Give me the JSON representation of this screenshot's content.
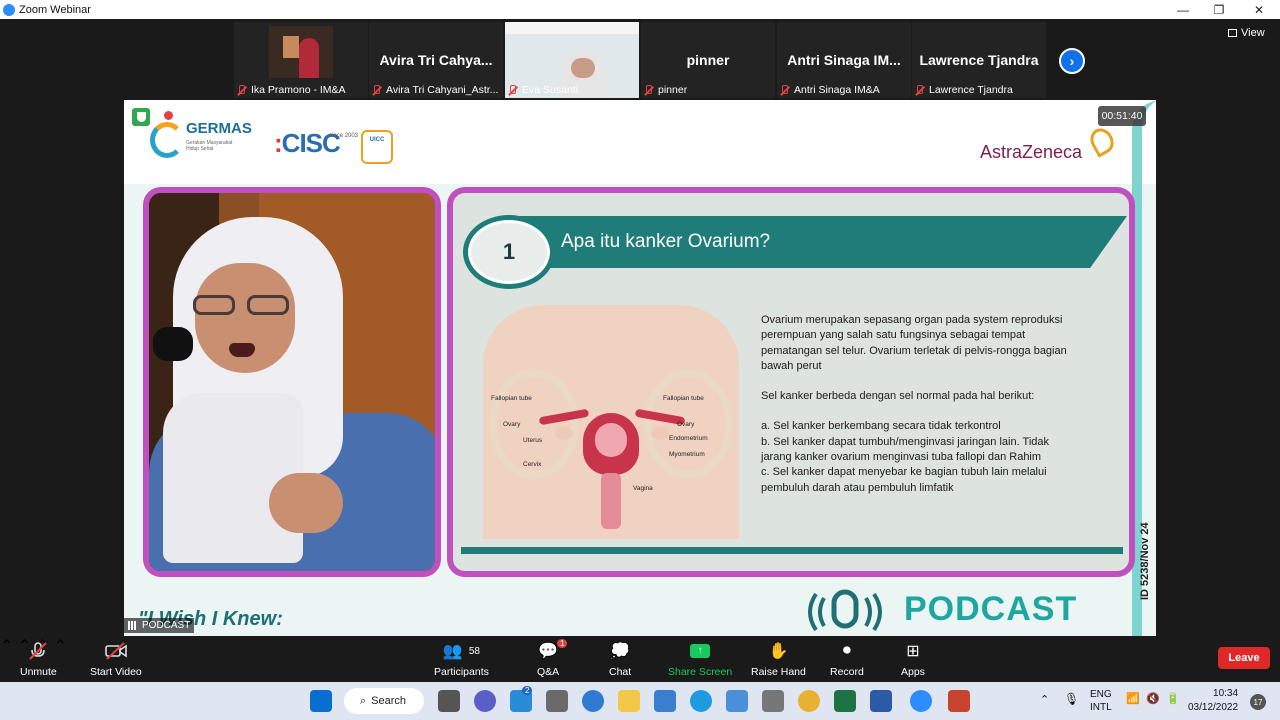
{
  "window": {
    "title": "Zoom Webinar",
    "controls": [
      "—",
      "❐",
      "✕"
    ]
  },
  "participants_strip": {
    "tiles": [
      {
        "display_name": "",
        "label": "Ika Pramono - IM&A",
        "has_video": true
      },
      {
        "display_name": "Avira Tri Cahya...",
        "label": "Avira Tri Cahyani_Astr...",
        "has_video": false
      },
      {
        "display_name": "",
        "label": "Eva Susanti",
        "has_video": true
      },
      {
        "display_name": "pinner",
        "label": "pinner",
        "has_video": false
      },
      {
        "display_name": "Antri Sinaga IM...",
        "label": "Antri Sinaga IM&A",
        "has_video": false
      },
      {
        "display_name": "Lawrence Tjandra",
        "label": "Lawrence Tjandra",
        "has_video": false
      }
    ],
    "next_icon": "chevron-right-icon",
    "view_label": "View"
  },
  "main_video": {
    "timer": "00:51:40",
    "logos": {
      "germas": "GERMAS",
      "germas_sub": "Gerakan Masyarakat Hidup Sehat",
      "cisc": "CISC",
      "cisc_tag": "since 2003",
      "uicc": "UICC",
      "astrazeneca": "AstraZeneca"
    },
    "slide": {
      "number": "1",
      "title": "Apa itu kanker Ovarium?",
      "diagram_labels": [
        "Fallopian tube",
        "Fallopian tube",
        "Ovary",
        "Ovary",
        "Uterus",
        "Endometrium",
        "Myometrium",
        "Cervix",
        "Vagina"
      ],
      "paragraph1": "Ovarium merupakan sepasang organ pada system reproduksi perempuan yang salah satu fungsinya sebagai tempat pematangan sel telur. Ovarium terletak di pelvis-rongga bagian bawah perut",
      "paragraph2": "Sel kanker berbeda dengan sel normal pada hal berikut:",
      "points": [
        "a. Sel kanker berkembang secara tidak terkontrol",
        "b. Sel kanker dapat tumbuh/menginvasi jaringan lain. Tidak jarang kanker ovarium menginvasi tuba fallopi dan Rahim",
        "c. Sel kanker dapat menyebar ke bagian tubuh lain melalui pembuluh darah atau pembuluh limfatik"
      ]
    },
    "id_code": "ID 5238/Nov 24",
    "wish_text": "\"I Wish I Knew:",
    "podcast_text": "PODCAST",
    "speaker_badge": "PODCAST"
  },
  "controls": {
    "unmute": "Unmute",
    "start_video": "Start Video",
    "participants": "Participants",
    "participants_count": "58",
    "qa": "Q&A",
    "qa_badge": "1",
    "chat": "Chat",
    "share_screen": "Share Screen",
    "raise_hand": "Raise Hand",
    "record": "Record",
    "apps": "Apps",
    "leave": "Leave"
  },
  "taskbar": {
    "search": "Search",
    "badge_count": "2",
    "lang_top": "ENG",
    "lang_bottom": "INTL",
    "time": "10:34",
    "date": "03/12/2022",
    "notifications": "17"
  },
  "colors": {
    "accent_teal": "#1f7c79",
    "frame_purple": "#c050c0",
    "zoom_blue": "#0e72ed",
    "leave_red": "#e02828",
    "share_green": "#17c95f"
  }
}
